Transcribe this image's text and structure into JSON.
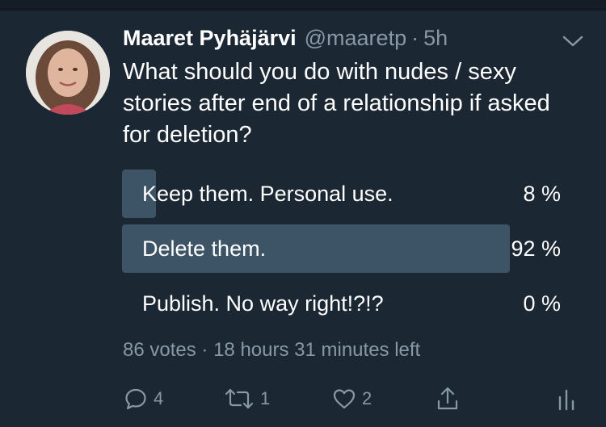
{
  "tweet": {
    "author_name": "Maaret Pyhäjärvi",
    "author_handle": "@maaretp",
    "separator": "·",
    "time": "5h",
    "text": "What should you do with nudes / sexy stories after end of a relationship if asked for deletion?"
  },
  "poll": {
    "options": [
      {
        "label": "Keep them. Personal use.",
        "percent_text": "8 %",
        "percent": 8
      },
      {
        "label": "Delete them.",
        "percent_text": "92 %",
        "percent": 92
      },
      {
        "label": "Publish. No way right!?!?",
        "percent_text": "0 %",
        "percent": 0
      }
    ],
    "votes": "86 votes",
    "meta_separator": "·",
    "time_left": "18 hours 31 minutes left"
  },
  "actions": {
    "reply_count": "4",
    "retweet_count": "1",
    "like_count": "2"
  },
  "colors": {
    "background": "#1b2733",
    "bar_fill": "#3d5466",
    "muted_text": "#8899a6"
  },
  "icons": [
    "chevron-down-icon",
    "reply-icon",
    "retweet-icon",
    "like-icon",
    "share-icon",
    "analytics-icon"
  ]
}
